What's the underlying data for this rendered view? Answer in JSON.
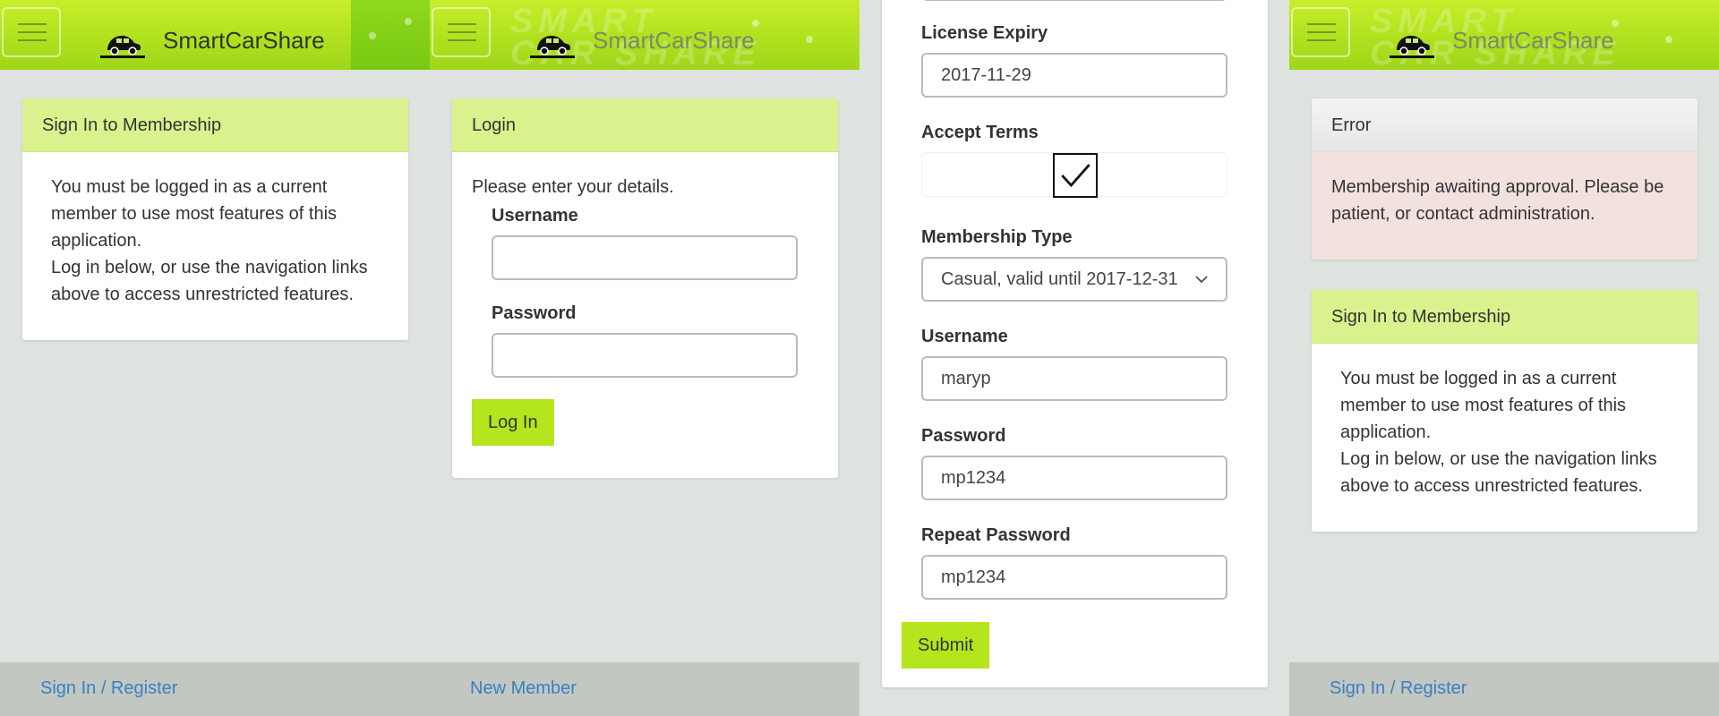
{
  "brand": {
    "name": "SmartCarShare",
    "icon": "car-icon",
    "deco_line1": "SMART",
    "deco_line2": "CAR SHARE"
  },
  "colors": {
    "accent": "#b5e51d",
    "header": "#aee01e",
    "card_head": "#d9f28e",
    "link": "#3a7fc1",
    "error_bg": "#f1e2de"
  },
  "panel1": {
    "card_title": "Sign In to Membership",
    "line1": "You must be logged in as a current member to use most features of this application.",
    "line2": "Log in below, or use the navigation links above to access unrestricted features.",
    "footer_link": "Sign In / Register"
  },
  "panel2": {
    "card_title": "Login",
    "intro": "Please enter your details.",
    "username_label": "Username",
    "username_value": "",
    "password_label": "Password",
    "password_value": "",
    "login_button": "Log In",
    "footer_link": "New Member"
  },
  "panel3": {
    "license_label": "License Expiry",
    "license_value": "2017-11-29",
    "terms_label": "Accept Terms",
    "terms_checked": true,
    "membership_label": "Membership Type",
    "membership_value": "Casual, valid until 2017-12-31",
    "username_label": "Username",
    "username_value": "maryp",
    "password_label": "Password",
    "password_value": "mp1234",
    "repeat_label": "Repeat Password",
    "repeat_value": "mp1234",
    "submit_button": "Submit"
  },
  "panel4": {
    "error_title": "Error",
    "error_message": "Membership awaiting approval. Please be patient, or contact administration.",
    "card_title": "Sign In to Membership",
    "line1": "You must be logged in as a current member to use most features of this application.",
    "line2": "Log in below, or use the navigation links above to access unrestricted features.",
    "footer_link": "Sign In / Register"
  }
}
